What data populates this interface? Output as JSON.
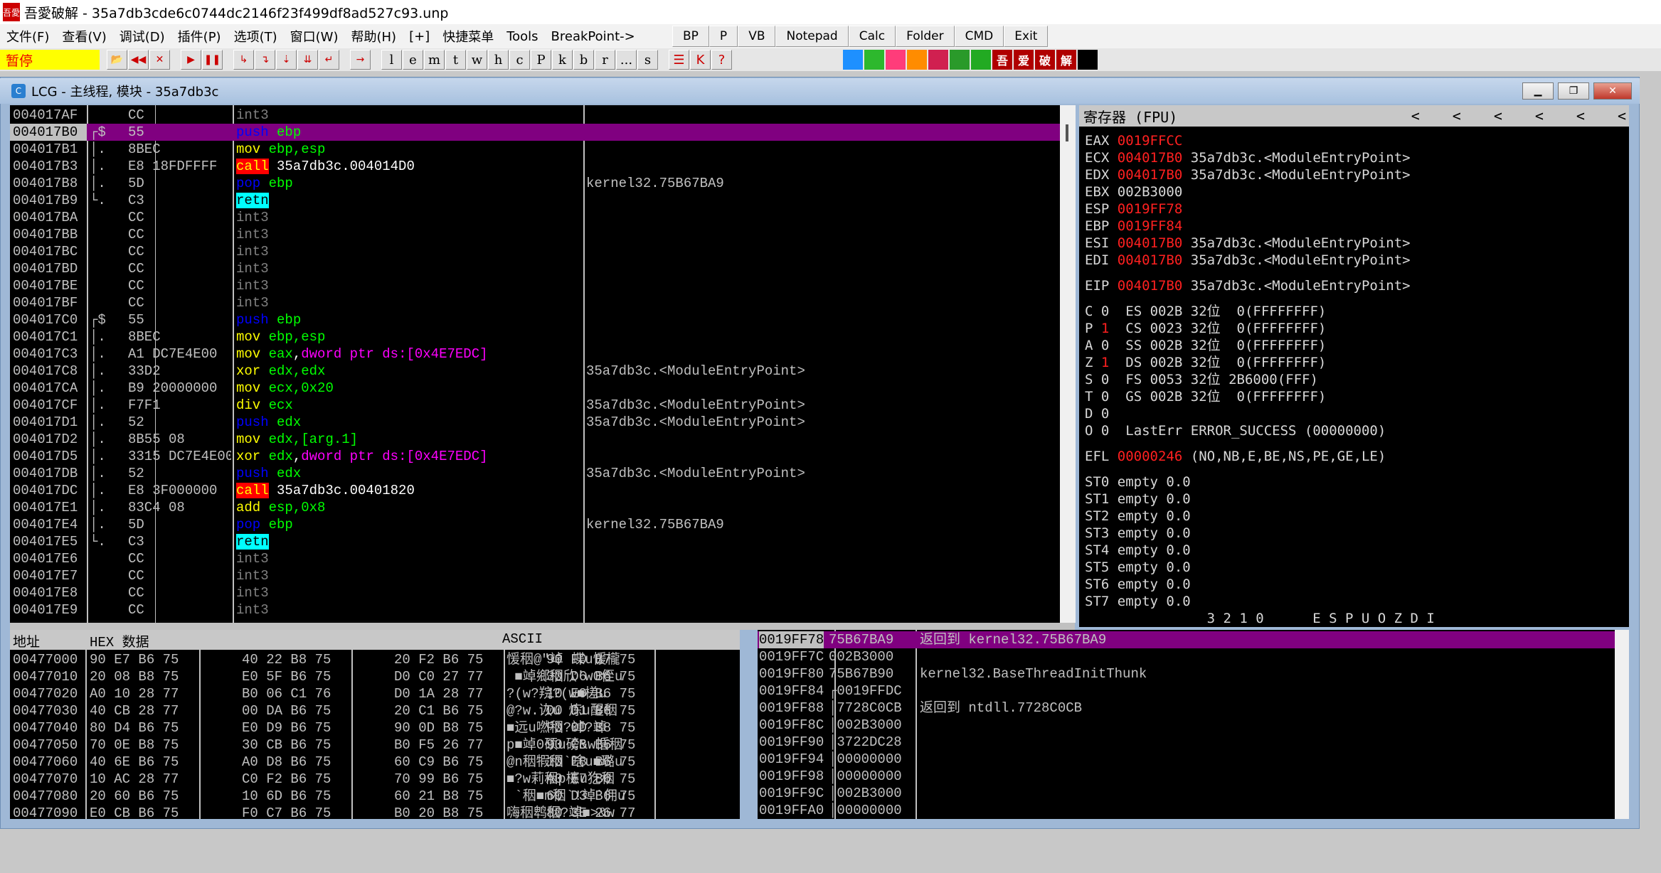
{
  "window": {
    "title": "吾愛破解 - 35a7db3cde6c0744dc2146f23f499df8ad527c93.unp",
    "app_icon": "吾愛"
  },
  "menu": [
    "文件(F)",
    "查看(V)",
    "调试(D)",
    "插件(P)",
    "选项(T)",
    "窗口(W)",
    "帮助(H)",
    "[+]",
    "快捷菜单",
    "Tools",
    "BreakPoint->"
  ],
  "quick_buttons": [
    "BP",
    "P",
    "VB",
    "Notepad",
    "Calc",
    "Folder",
    "CMD",
    "Exit"
  ],
  "toolbar": {
    "status": "暂停",
    "icons": [
      "open-icon",
      "restart-icon",
      "close-icon",
      "run-icon",
      "pause-icon",
      "step-into-icon",
      "step-over-icon",
      "trace-into-icon",
      "trace-over-icon",
      "execute-till-return-icon",
      "goto-icon"
    ],
    "letters": [
      "l",
      "e",
      "m",
      "t",
      "w",
      "h",
      "c",
      "P",
      "k",
      "b",
      "r",
      "...",
      "s"
    ],
    "extra": [
      "list-icon",
      "k-icon",
      "?"
    ],
    "right_icons": [
      {
        "name": "refresh-icon",
        "color": "#1e90ff"
      },
      {
        "name": "pause-green-icon",
        "color": "#2db82d"
      },
      {
        "name": "a-icon",
        "color": "#ff3c7a"
      },
      {
        "name": "record-icon",
        "color": "#ff8c00"
      },
      {
        "name": "target-icon",
        "color": "#d02050"
      },
      {
        "name": "grid-icon",
        "color": "#2a9a2a"
      },
      {
        "name": "window-icon",
        "color": "#22aa22"
      },
      {
        "name": "wu-icon",
        "color": "#b00000",
        "text": "吾"
      },
      {
        "name": "ai-icon",
        "color": "#b00000",
        "text": "爱"
      },
      {
        "name": "po-icon",
        "color": "#b00000",
        "text": "破"
      },
      {
        "name": "jie-icon",
        "color": "#b00000",
        "text": "解"
      },
      {
        "name": "black-icon",
        "color": "#000000"
      }
    ]
  },
  "mdi": {
    "title": "LCG - 主线程, 模块 - 35a7db3c",
    "icon": "C"
  },
  "disasm": {
    "rows": [
      {
        "addr": "004017AF",
        "flow": "",
        "hex": "CC",
        "op": "int3",
        "args": "",
        "comment": ""
      },
      {
        "addr": "004017B0",
        "flow": "┌$",
        "hex": "55",
        "op": "push",
        "args": "ebp",
        "comment": "",
        "selected": true
      },
      {
        "addr": "004017B1",
        "flow": "│.",
        "hex": "8BEC",
        "op": "mov",
        "args": "ebp,esp",
        "comment": ""
      },
      {
        "addr": "004017B3",
        "flow": "│.",
        "hex": "E8 18FDFFFF",
        "op": "call",
        "args": "35a7db3c.004014D0",
        "comment": ""
      },
      {
        "addr": "004017B8",
        "flow": "│.",
        "hex": "5D",
        "op": "pop",
        "args": "ebp",
        "comment": "kernel32.75B67BA9"
      },
      {
        "addr": "004017B9",
        "flow": "└.",
        "hex": "C3",
        "op": "retn",
        "args": "",
        "comment": ""
      },
      {
        "addr": "004017BA",
        "flow": "",
        "hex": "CC",
        "op": "int3",
        "args": "",
        "comment": ""
      },
      {
        "addr": "004017BB",
        "flow": "",
        "hex": "CC",
        "op": "int3",
        "args": "",
        "comment": ""
      },
      {
        "addr": "004017BC",
        "flow": "",
        "hex": "CC",
        "op": "int3",
        "args": "",
        "comment": ""
      },
      {
        "addr": "004017BD",
        "flow": "",
        "hex": "CC",
        "op": "int3",
        "args": "",
        "comment": ""
      },
      {
        "addr": "004017BE",
        "flow": "",
        "hex": "CC",
        "op": "int3",
        "args": "",
        "comment": ""
      },
      {
        "addr": "004017BF",
        "flow": "",
        "hex": "CC",
        "op": "int3",
        "args": "",
        "comment": ""
      },
      {
        "addr": "004017C0",
        "flow": "┌$",
        "hex": "55",
        "op": "push",
        "args": "ebp",
        "comment": ""
      },
      {
        "addr": "004017C1",
        "flow": "│.",
        "hex": "8BEC",
        "op": "mov",
        "args": "ebp,esp",
        "comment": ""
      },
      {
        "addr": "004017C3",
        "flow": "│.",
        "hex": "A1 DC7E4E00",
        "op": "mov",
        "args": "eax,dword ptr ds:[0x4E7EDC]",
        "comment": ""
      },
      {
        "addr": "004017C8",
        "flow": "│.",
        "hex": "33D2",
        "op": "xor",
        "args": "edx,edx",
        "comment": "35a7db3c.<ModuleEntryPoint>"
      },
      {
        "addr": "004017CA",
        "flow": "│.",
        "hex": "B9 20000000",
        "op": "mov",
        "args": "ecx,0x20",
        "comment": ""
      },
      {
        "addr": "004017CF",
        "flow": "│.",
        "hex": "F7F1",
        "op": "div",
        "args": "ecx",
        "comment": "35a7db3c.<ModuleEntryPoint>"
      },
      {
        "addr": "004017D1",
        "flow": "│.",
        "hex": "52",
        "op": "push",
        "args": "edx",
        "comment": "35a7db3c.<ModuleEntryPoint>"
      },
      {
        "addr": "004017D2",
        "flow": "│.",
        "hex": "8B55 08",
        "op": "mov",
        "args": "edx,[arg.1]",
        "comment": ""
      },
      {
        "addr": "004017D5",
        "flow": "│.",
        "hex": "3315 DC7E4E00",
        "op": "xor",
        "args": "edx,dword ptr ds:[0x4E7EDC]",
        "comment": ""
      },
      {
        "addr": "004017DB",
        "flow": "│.",
        "hex": "52",
        "op": "push",
        "args": "edx",
        "comment": "35a7db3c.<ModuleEntryPoint>"
      },
      {
        "addr": "004017DC",
        "flow": "│.",
        "hex": "E8 3F000000",
        "op": "call",
        "args": "35a7db3c.00401820",
        "comment": ""
      },
      {
        "addr": "004017E1",
        "flow": "│.",
        "hex": "83C4 08",
        "op": "add",
        "args": "esp,0x8",
        "comment": ""
      },
      {
        "addr": "004017E4",
        "flow": "│.",
        "hex": "5D",
        "op": "pop",
        "args": "ebp",
        "comment": "kernel32.75B67BA9"
      },
      {
        "addr": "004017E5",
        "flow": "└.",
        "hex": "C3",
        "op": "retn",
        "args": "",
        "comment": ""
      },
      {
        "addr": "004017E6",
        "flow": "",
        "hex": "CC",
        "op": "int3",
        "args": "",
        "comment": ""
      },
      {
        "addr": "004017E7",
        "flow": "",
        "hex": "CC",
        "op": "int3",
        "args": "",
        "comment": ""
      },
      {
        "addr": "004017E8",
        "flow": "",
        "hex": "CC",
        "op": "int3",
        "args": "",
        "comment": ""
      },
      {
        "addr": "004017E9",
        "flow": "",
        "hex": "CC",
        "op": "int3",
        "args": "",
        "comment": ""
      }
    ]
  },
  "registers": {
    "title": "寄存器 (FPU)",
    "arrows": [
      "<",
      "<",
      "<",
      "<",
      "<",
      "<"
    ],
    "gpr": [
      {
        "name": "EAX",
        "value": "0019FFCC",
        "changed": true,
        "comment": ""
      },
      {
        "name": "ECX",
        "value": "004017B0",
        "changed": true,
        "comment": "35a7db3c.<ModuleEntryPoint>"
      },
      {
        "name": "EDX",
        "value": "004017B0",
        "changed": true,
        "comment": "35a7db3c.<ModuleEntryPoint>"
      },
      {
        "name": "EBX",
        "value": "002B3000",
        "changed": false,
        "comment": ""
      },
      {
        "name": "ESP",
        "value": "0019FF78",
        "changed": true,
        "comment": ""
      },
      {
        "name": "EBP",
        "value": "0019FF84",
        "changed": true,
        "comment": ""
      },
      {
        "name": "ESI",
        "value": "004017B0",
        "changed": true,
        "comment": "35a7db3c.<ModuleEntryPoint>"
      },
      {
        "name": "EDI",
        "value": "004017B0",
        "changed": true,
        "comment": "35a7db3c.<ModuleEntryPoint>"
      }
    ],
    "eip": {
      "name": "EIP",
      "value": "004017B0",
      "changed": true,
      "comment": "35a7db3c.<ModuleEntryPoint>"
    },
    "flags": [
      {
        "flag": "C",
        "bit": "0",
        "changed": false,
        "seg": "ES 002B 32位  0(FFFFFFFF)"
      },
      {
        "flag": "P",
        "bit": "1",
        "changed": true,
        "seg": "CS 0023 32位  0(FFFFFFFF)"
      },
      {
        "flag": "A",
        "bit": "0",
        "changed": false,
        "seg": "SS 002B 32位  0(FFFFFFFF)"
      },
      {
        "flag": "Z",
        "bit": "1",
        "changed": true,
        "seg": "DS 002B 32位  0(FFFFFFFF)"
      },
      {
        "flag": "S",
        "bit": "0",
        "changed": false,
        "seg": "FS 0053 32位 2B6000(FFF)"
      },
      {
        "flag": "T",
        "bit": "0",
        "changed": false,
        "seg": "GS 002B 32位  0(FFFFFFFF)"
      },
      {
        "flag": "D",
        "bit": "0",
        "changed": false,
        "seg": ""
      },
      {
        "flag": "O",
        "bit": "0",
        "changed": false,
        "seg": "LastErr ERROR_SUCCESS (00000000)"
      }
    ],
    "efl": {
      "name": "EFL",
      "value": "00000246",
      "changed": true,
      "comment": "(NO,NB,E,BE,NS,PE,GE,LE)"
    },
    "fpu": [
      "ST0 empty 0.0",
      "ST1 empty 0.0",
      "ST2 empty 0.0",
      "ST3 empty 0.0",
      "ST4 empty 0.0",
      "ST5 empty 0.0",
      "ST6 empty 0.0",
      "ST7 empty 0.0"
    ],
    "fpu_status_header": "               3 2 1 0      E S P U O Z D I"
  },
  "dump": {
    "headers": {
      "addr": "地址",
      "hex": "HEX 数据",
      "ascii": "ASCII"
    },
    "rows": [
      {
        "addr": "00477000",
        "hex": [
          "90 E7 B6 75",
          "40 22 B8 75",
          "20 F2 B6 75",
          "90 FD B7 75"
        ],
        "ascii": "愋秵@\"竨 蝶u愋櫳"
      },
      {
        "addr": "00477010",
        "hex": [
          "20 08 B8 75",
          "E0 5F B6 75",
          "D0 C0 27 77",
          "30 D6 B6 75"
        ],
        "ascii": " ■竨鄉秵欣'w0侄u"
      },
      {
        "addr": "00477020",
        "hex": [
          "A0 10 28 77",
          "B0 06 C1 76",
          "D0 1A 28 77",
          "10 E9 B6 75"
        ],
        "ascii": "?(w?羦?(w■槎u"
      },
      {
        "addr": "00477030",
        "hex": [
          "40 CB 28 77",
          "00 DA B6 75",
          "20 C1 B6 75",
          "D0 D1 B6 75"
        ],
        "ascii": "@?w.诙u 炼u醒秵"
      },
      {
        "addr": "00477040",
        "hex": [
          "80 D4 B6 75",
          "E0 D9 B6 75",
          "90 0D B8 75",
          "F0 0D B8 75"
        ],
        "ascii": "■远u嘫秵?竨?竨"
      },
      {
        "addr": "00477050",
        "hex": [
          "70 0E B8 75",
          "30 CB B6 75",
          "B0 F5 26 77",
          "90 CB B6 75"
        ],
        "ascii": "p■竨0硕u磅&w惛秵"
      },
      {
        "addr": "00477060",
        "hex": [
          "40 6E B6 75",
          "A0 D8 B6 75",
          "60 C9 B6 75",
          "10 E8 B6 75"
        ],
        "ascii": "@n秵犌秵`啥u■璐u"
      },
      {
        "addr": "00477070",
        "hex": [
          "10 AC 28 77",
          "C0 F2 B6 75",
          "70 99 B6 75",
          "A0 E7 B6 75"
        ],
        "ascii": "■?w莉秵p櫶u犵秵"
      },
      {
        "addr": "00477080",
        "hex": [
          "20 60 B6 75",
          "10 6D B6 75",
          "60 21 B8 75",
          "60 D3 B6 75"
        ],
        "ascii": " `秵■m秵`!竨`佣u"
      },
      {
        "addr": "00477090",
        "hex": [
          "E0 CB B6 75",
          "F0 C7 B6 75",
          "B0 20 B8 75",
          "80 3E 26 77"
        ],
        "ascii": "嗨秵鹎秵?竨■>&w"
      }
    ]
  },
  "stack": {
    "rows": [
      {
        "addr": "0019FF78",
        "value": "75B67BA9",
        "comment": "返回到 kernel32.75B67BA9",
        "selected": true
      },
      {
        "addr": "0019FF7C",
        "value": "002B3000",
        "comment": ""
      },
      {
        "addr": "0019FF80",
        "value": "75B67B90",
        "comment": "kernel32.BaseThreadInitThunk"
      },
      {
        "addr": "0019FF84",
        "value": "┌0019FFDC",
        "comment": ""
      },
      {
        "addr": "0019FF88",
        "value": "│7728C0CB",
        "comment": "返回到 ntdll.7728C0CB"
      },
      {
        "addr": "0019FF8C",
        "value": "│002B3000",
        "comment": ""
      },
      {
        "addr": "0019FF90",
        "value": "│3722DC28",
        "comment": ""
      },
      {
        "addr": "0019FF94",
        "value": "│00000000",
        "comment": ""
      },
      {
        "addr": "0019FF98",
        "value": "│00000000",
        "comment": ""
      },
      {
        "addr": "0019FF9C",
        "value": "│002B3000",
        "comment": ""
      },
      {
        "addr": "0019FFA0",
        "value": "│00000000",
        "comment": ""
      }
    ]
  },
  "colors": {
    "selection": "#800080",
    "changed": "#ff2020",
    "call_bg": "#ff0000",
    "retn_bg": "#00ffff",
    "status_bg": "#ffff00"
  }
}
